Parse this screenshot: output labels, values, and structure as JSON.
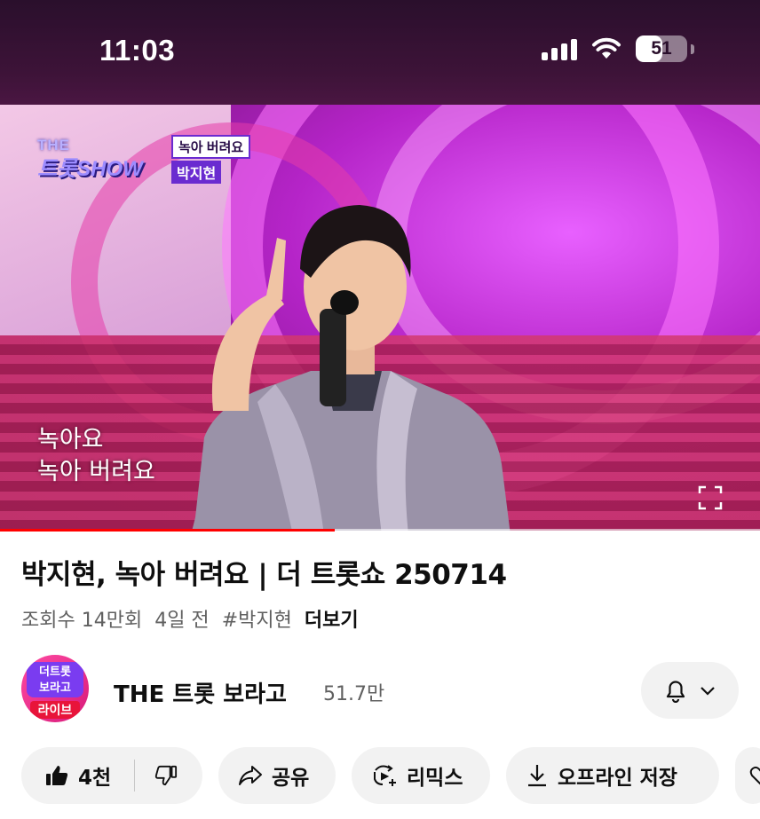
{
  "status_bar": {
    "time": "11:03",
    "battery_level": "51",
    "battery_fraction": 0.51
  },
  "video": {
    "logo_the": "THE",
    "logo_main": "트롯SHOW",
    "song_tag": "녹아 버려요",
    "artist_tag": "박지현",
    "subtitle_line1": "녹아요",
    "subtitle_line2": "녹아 버려요",
    "progress_fraction": 0.44,
    "progress_color": "#ff0000"
  },
  "info": {
    "title": "박지현, 녹아 버려요 | 더 트롯쇼 250714",
    "views": "조회수 14만회",
    "age": "4일 전",
    "hashtag": "#박지현",
    "more_label": "더보기"
  },
  "channel": {
    "avatar_text_1": "더트롯",
    "avatar_text_2": "보라고",
    "avatar_badge": "라이브",
    "name": "THE 트롯 보라고",
    "subscribers": "51.7만"
  },
  "actions": {
    "like_count": "4천",
    "share_label": "공유",
    "remix_label": "리믹스",
    "offline_label": "오프라인 저장"
  },
  "icons": {
    "signal": "signal-icon",
    "wifi": "wifi-icon",
    "battery": "battery-icon",
    "fullscreen": "fullscreen-icon",
    "bell": "bell-icon",
    "chevron": "chevron-down-icon",
    "like": "thumbs-up-icon",
    "dislike": "thumbs-down-icon",
    "share": "share-icon",
    "remix": "remix-icon",
    "download": "download-icon",
    "save": "heart-icon"
  }
}
